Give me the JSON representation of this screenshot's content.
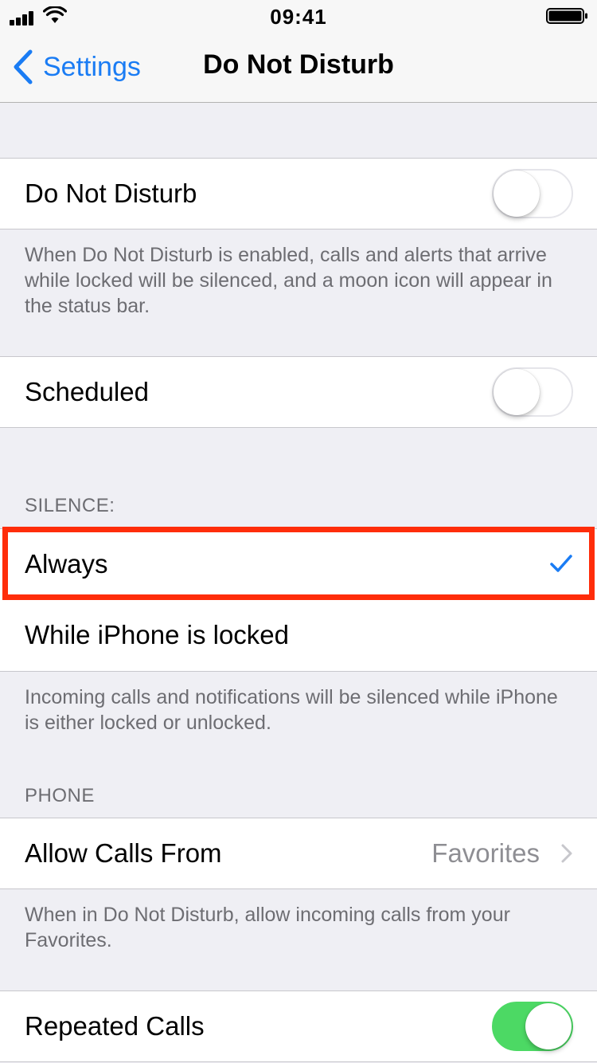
{
  "status_bar": {
    "time": "09:41"
  },
  "nav": {
    "back_label": "Settings",
    "title": "Do Not Disturb"
  },
  "dnd": {
    "label": "Do Not Disturb",
    "enabled": false,
    "footer": "When Do Not Disturb is enabled, calls and alerts that arrive while locked will be silenced, and a moon icon will appear in the status bar."
  },
  "scheduled": {
    "label": "Scheduled",
    "enabled": false
  },
  "silence": {
    "header": "SILENCE:",
    "options": [
      {
        "label": "Always",
        "selected": true
      },
      {
        "label": "While iPhone is locked",
        "selected": false
      }
    ],
    "footer": "Incoming calls and notifications will be silenced while iPhone is either locked or unlocked."
  },
  "phone": {
    "header": "PHONE",
    "allow_calls_label": "Allow Calls From",
    "allow_calls_value": "Favorites",
    "footer": "When in Do Not Disturb, allow incoming calls from your Favorites."
  },
  "repeated_calls": {
    "label": "Repeated Calls",
    "enabled": true
  },
  "colors": {
    "accent": "#1a7cf4",
    "toggle_on": "#4cd964",
    "highlight": "#ff2d0a",
    "background": "#efeff4"
  }
}
